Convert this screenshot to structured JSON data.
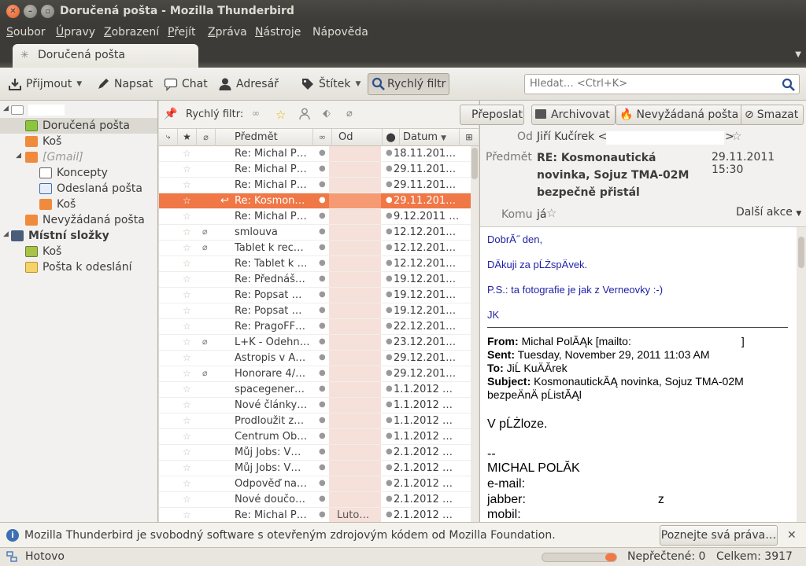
{
  "window": {
    "title": "Doručená pošta - Mozilla Thunderbird"
  },
  "menu": [
    {
      "u": "S",
      "rest": "oubor"
    },
    {
      "u": "Ú",
      "rest": "pravy"
    },
    {
      "u": "Z",
      "rest": "obrazení"
    },
    {
      "u": "P",
      "rest": "řejít"
    },
    {
      "u": "Z",
      "rest": "práva"
    },
    {
      "u": "N",
      "rest": "ástroje"
    },
    {
      "u": "N",
      "rest": "ápověda"
    }
  ],
  "tab": {
    "label": "Doručená pošta"
  },
  "toolbar": {
    "get": "Přijmout",
    "write": "Napsat",
    "chat": "Chat",
    "address": "Adresář",
    "tag": "Štítek",
    "quickfilter": "Rychlý filtr"
  },
  "search": {
    "placeholder": "Hledat… <Ctrl+K>"
  },
  "folders": [
    {
      "label": "Doručená pošta"
    },
    {
      "label": "Koš"
    },
    {
      "label": "[Gmail]"
    },
    {
      "label": "Koncepty"
    },
    {
      "label": "Odeslaná pošta"
    },
    {
      "label": "Koš"
    },
    {
      "label": "Nevyžádaná pošta"
    },
    {
      "label": "Místní složky"
    },
    {
      "label": "Koš"
    },
    {
      "label": "Pošta k odeslání"
    }
  ],
  "quickfilter_bar": {
    "label": "Rychlý filtr:"
  },
  "columns": {
    "subject": "Předmět",
    "from": "Od",
    "date": "Datum"
  },
  "messages": [
    {
      "subject": "Re: Michal P…",
      "date": "18.11.201…",
      "att": false
    },
    {
      "subject": "Re: Michal P…",
      "date": "29.11.201…",
      "att": false
    },
    {
      "subject": "Re: Michal P…",
      "date": "29.11.201…",
      "att": false
    },
    {
      "subject": "Re: Kosmon…",
      "date": "29.11.201…",
      "att": false,
      "selected": true
    },
    {
      "subject": "Re: Michal P…",
      "date": "9.12.2011 …",
      "att": false
    },
    {
      "subject": "smlouva",
      "date": "12.12.201…",
      "att": true
    },
    {
      "subject": "Tablet k rec…",
      "date": "12.12.201…",
      "att": true
    },
    {
      "subject": "Re: Tablet k …",
      "date": "12.12.201…",
      "att": false
    },
    {
      "subject": "Re: Přednáš…",
      "date": "19.12.201…",
      "att": false
    },
    {
      "subject": "Re: Popsat …",
      "date": "19.12.201…",
      "att": false
    },
    {
      "subject": "Re: Popsat …",
      "date": "19.12.201…",
      "att": false
    },
    {
      "subject": "Re: PragoFF…",
      "date": "22.12.201…",
      "att": false
    },
    {
      "subject": "L+K - Odehn…",
      "date": "23.12.201…",
      "att": true
    },
    {
      "subject": "Astropis v A…",
      "date": "29.12.201…",
      "att": false
    },
    {
      "subject": "Honorare 4/…",
      "date": "29.12.201…",
      "att": true
    },
    {
      "subject": "spacegener…",
      "date": "1.1.2012 …",
      "att": false
    },
    {
      "subject": "Nové článk​y…",
      "date": "1.1.2012 …",
      "att": false
    },
    {
      "subject": "Prodloužit z…",
      "date": "1.1.2012 …",
      "att": false
    },
    {
      "subject": "Centrum Ob…",
      "date": "1.1.2012 …",
      "att": false
    },
    {
      "subject": "Můj Jobs: V…",
      "date": "2.1.2012 …",
      "att": false
    },
    {
      "subject": "Můj Jobs: V…",
      "date": "2.1.2012 …",
      "att": false
    },
    {
      "subject": "Odpověď na…",
      "date": "2.1.2012 …",
      "att": false
    },
    {
      "subject": "Nové doučo…",
      "date": "2.1.2012 …",
      "att": false
    },
    {
      "subject": "Re: Michal P…",
      "date": "2.1.2012 …",
      "att": false,
      "from": "Luto…"
    }
  ],
  "header": {
    "buttons": {
      "forward": "Přeposlat",
      "archive": "Archivovat",
      "junk": "Nevyžádaná pošta",
      "delete": "Smazat"
    },
    "from_label": "Od",
    "from_value": "Jiří Kučírek <",
    "from_end": ">",
    "subject_label": "Předmět",
    "subject_value": "RE: Kosmonautická novinka, Sojuz TMA-02M bezpečně přistál",
    "date": "29.11.2011 15:30",
    "to_label": "Komu",
    "to_value": "já",
    "more_actions": "Další akce"
  },
  "body": {
    "l1": "DobrĂ˝ den,",
    "l2": "DÄkuji za pĹŻspÄvek.",
    "l3": "P.S.: ta fotografie je jak z Verneovky :-)",
    "l4": "JK",
    "from_key": "From:",
    "from_val": "Michal PolĂĄk [mailto:",
    "from_end": "]",
    "sent_key": "Sent:",
    "sent_val": "Tuesday, November 29, 2011 11:03 AM",
    "to_key": "To:",
    "to_val": "JiĹ KuÄĂrek",
    "subj_key": "Subject:",
    "subj_val": "KosmonautickĂĄ novinka, Sojuz TMA-02M",
    "subj_val2": "bezpeÄnÄ pĹistĂĄl",
    "attach": "V pĹŻloze.",
    "sig_dash": "--",
    "sig_name": "MICHAL POLĂK",
    "sig_email": "e-mail:",
    "sig_jabber": "jabber:",
    "sig_jabber_end": "z",
    "sig_mobil": "mobil:"
  },
  "notification": {
    "text": "Mozilla Thunderbird je svobodný software s otevřeným zdrojovým kódem od Mozilla Foundation.",
    "button": "Poznejte svá práva…"
  },
  "status": {
    "text": "Hotovo",
    "unread": "Nepřečtené: 0",
    "total": "Celkem: 3917",
    "progress": 0.15
  },
  "colors": {
    "accent": "#f07746",
    "titlebar": "#3c3b37"
  }
}
